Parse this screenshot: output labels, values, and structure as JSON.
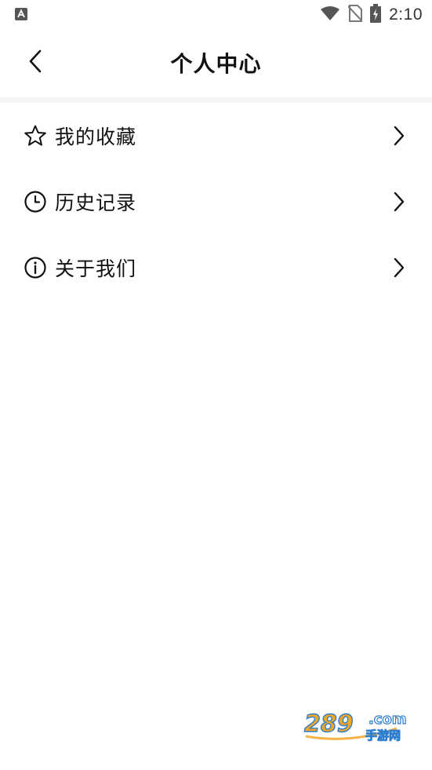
{
  "status_bar": {
    "time": "2:10",
    "icons": [
      "notification-a-icon",
      "wifi-icon",
      "no-sim-icon",
      "battery-charging-icon"
    ]
  },
  "header": {
    "title": "个人中心",
    "back_icon": "chevron-left-icon"
  },
  "menu": {
    "items": [
      {
        "label": "我的收藏",
        "icon": "star-icon",
        "chevron": "chevron-right-icon"
      },
      {
        "label": "历史记录",
        "icon": "clock-icon",
        "chevron": "chevron-right-icon"
      },
      {
        "label": "关于我们",
        "icon": "info-icon",
        "chevron": "chevron-right-icon"
      }
    ]
  },
  "watermark": {
    "number": "289",
    "domain": ".com",
    "tagline": "手游网",
    "colors": {
      "orange": "#f5a623",
      "blue": "#2f7fd1"
    }
  }
}
